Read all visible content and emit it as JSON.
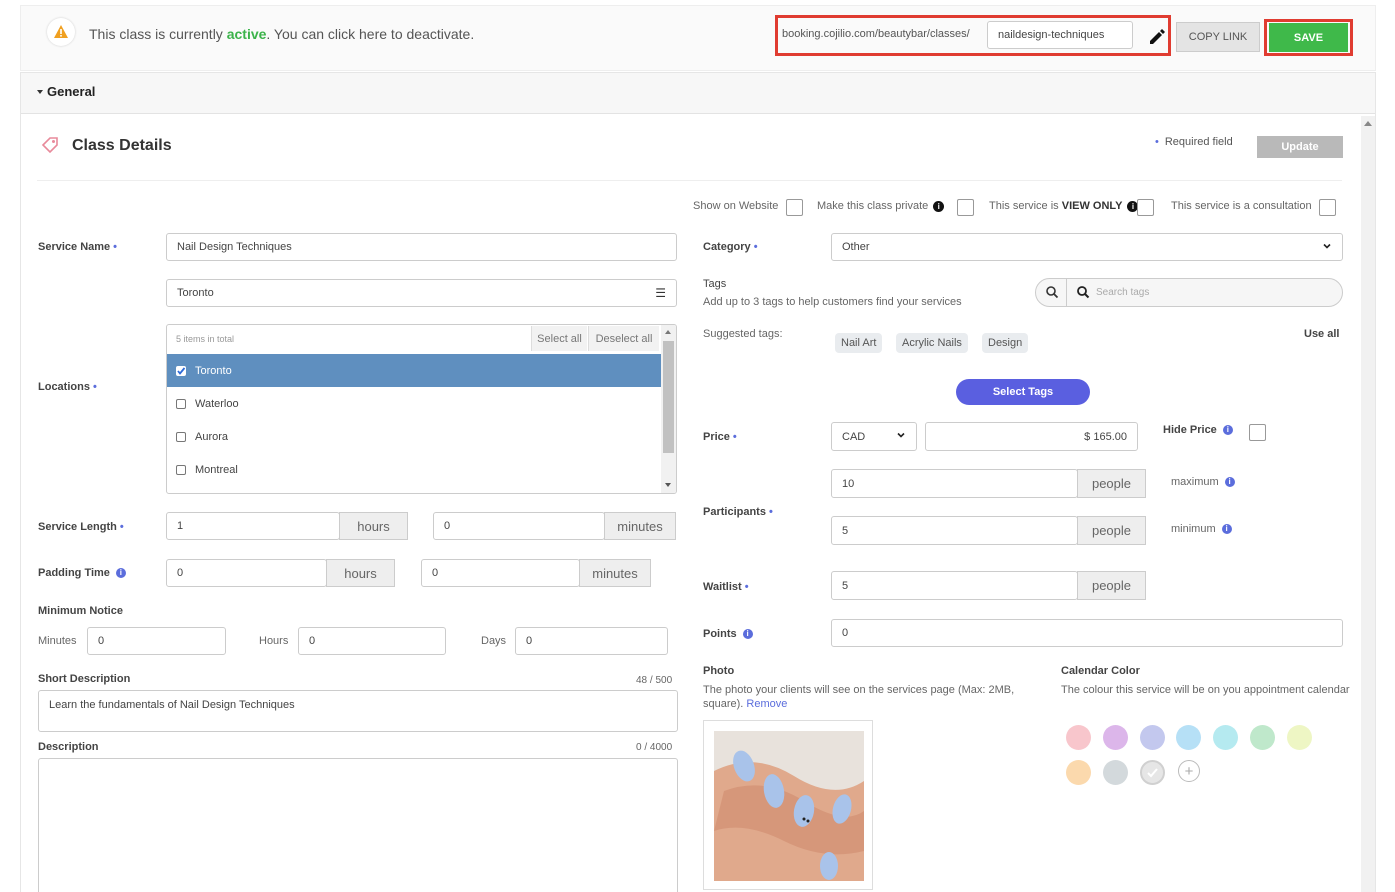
{
  "banner": {
    "prefix": "This class is currently ",
    "status": "active",
    "suffix": ". You can click here to deactivate.",
    "url_base": "booking.cojilio.com/beautybar/classes/",
    "slug": "naildesign-techniques",
    "copy_link": "COPY LINK",
    "save": "SAVE"
  },
  "section": {
    "title": "General"
  },
  "details": {
    "title": "Class Details",
    "required_note": "Required field",
    "update": "Update"
  },
  "options": {
    "show_on_website": "Show on Website",
    "make_private": "Make this class private",
    "view_only_prefix": "This service is ",
    "view_only_strong": "VIEW ONLY",
    "consultation": "This service is a consultation"
  },
  "service_name": {
    "label": "Service Name",
    "value": "Nail Design Techniques"
  },
  "locations": {
    "label": "Locations",
    "selected_display": "Toronto",
    "count_text": "5 items in total",
    "select_all": "Select all",
    "deselect_all": "Deselect all",
    "items": [
      {
        "label": "Toronto",
        "checked": true
      },
      {
        "label": "Waterloo",
        "checked": false
      },
      {
        "label": "Aurora",
        "checked": false
      },
      {
        "label": "Montreal",
        "checked": false
      }
    ]
  },
  "service_length": {
    "label": "Service Length",
    "hours": "1",
    "hours_unit": "hours",
    "minutes": "0",
    "minutes_unit": "minutes"
  },
  "padding_time": {
    "label": "Padding Time",
    "hours": "0",
    "hours_unit": "hours",
    "minutes": "0",
    "minutes_unit": "minutes"
  },
  "minimum_notice": {
    "label": "Minimum Notice",
    "minutes_label": "Minutes",
    "minutes": "0",
    "hours_label": "Hours",
    "hours": "0",
    "days_label": "Days",
    "days": "0"
  },
  "short_description": {
    "label": "Short Description",
    "counter": "48 / 500",
    "value": "Learn the fundamentals of Nail Design Techniques"
  },
  "description": {
    "label": "Description",
    "counter": "0 / 4000",
    "value": ""
  },
  "category": {
    "label": "Category",
    "value": "Other"
  },
  "tags": {
    "label": "Tags",
    "help": "Add up to 3 tags to help customers find your services",
    "search_placeholder": "Search tags",
    "suggested_label": "Suggested tags:",
    "suggested": [
      "Nail Art",
      "Acrylic Nails",
      "Design"
    ],
    "use_all": "Use all",
    "select_button": "Select Tags"
  },
  "price": {
    "label": "Price",
    "currency": "CAD",
    "value": "$ 165.00",
    "hide_label": "Hide Price"
  },
  "participants": {
    "label": "Participants",
    "max": "10",
    "min": "5",
    "unit": "people",
    "max_label": "maximum",
    "min_label": "minimum"
  },
  "waitlist": {
    "label": "Waitlist",
    "value": "5",
    "unit": "people"
  },
  "points": {
    "label": "Points",
    "value": "0"
  },
  "photo": {
    "label": "Photo",
    "help": "The photo your clients will see on the services page (Max: 2MB, square).",
    "remove": "Remove"
  },
  "calendar_color": {
    "label": "Calendar Color",
    "help": "The colour this service will be on you appointment calendar",
    "colors": [
      "#f8c6cc",
      "#dcb6ea",
      "#c3c8ee",
      "#b6e0f6",
      "#b5eaf0",
      "#bfe8cb",
      "#eef6c4",
      "#fbd9ad",
      "#d3d9dc",
      "#e6e6e6"
    ]
  }
}
